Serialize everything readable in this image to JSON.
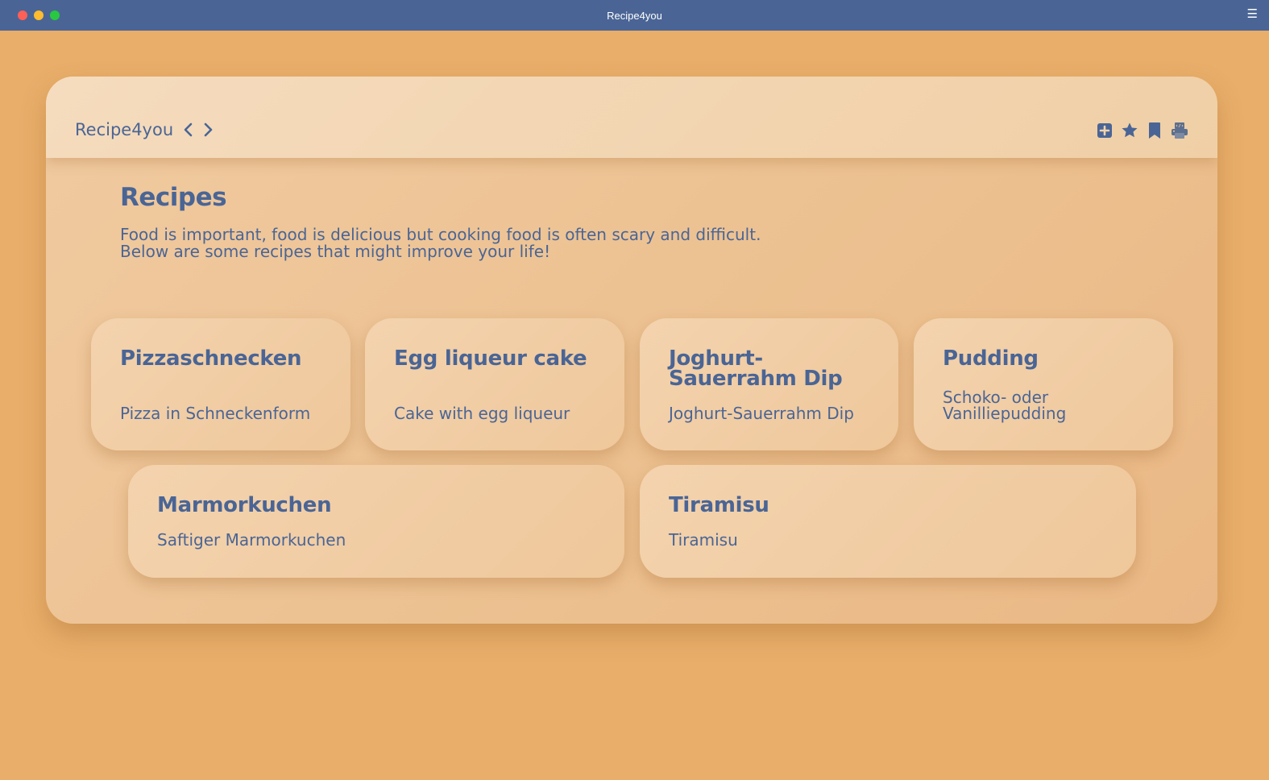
{
  "window": {
    "title": "Recipe4you"
  },
  "header": {
    "brand": "Recipe4you",
    "icons": [
      "back-chevron-icon",
      "forward-chevron-icon",
      "add-square-icon",
      "star-icon",
      "bookmark-icon",
      "printer-icon"
    ]
  },
  "main": {
    "title": "Recipes",
    "intro_line1": "Food is important, food is delicious but cooking food is often scary and difficult.",
    "intro_line2": "Below are some recipes that might improve your life!"
  },
  "recipes": [
    {
      "title_line1": "Pizzaschnecken",
      "title_line2": "",
      "desc_line1": "Pizza in Schneckenform",
      "desc_line2": ""
    },
    {
      "title_line1": "Egg liqueur cake",
      "title_line2": "",
      "desc_line1": "Cake with egg liqueur",
      "desc_line2": ""
    },
    {
      "title_line1": "Joghurt-",
      "title_line2": "Sauerrahm Dip",
      "desc_line1": "Joghurt-Sauerrahm Dip",
      "desc_line2": ""
    },
    {
      "title_line1": "Pudding",
      "title_line2": "",
      "desc_line1": "Schoko- oder",
      "desc_line2": "Vanilliepudding"
    },
    {
      "title_line1": "Marmorkuchen",
      "title_line2": "",
      "desc_line1": "Saftiger Marmorkuchen",
      "desc_line2": ""
    },
    {
      "title_line1": "Tiramisu",
      "title_line2": "",
      "desc_line1": "Tiramisu",
      "desc_line2": ""
    }
  ],
  "colors": {
    "accent": "#4a6595",
    "background": "#e8ae6a",
    "card": "#f0c99d"
  }
}
